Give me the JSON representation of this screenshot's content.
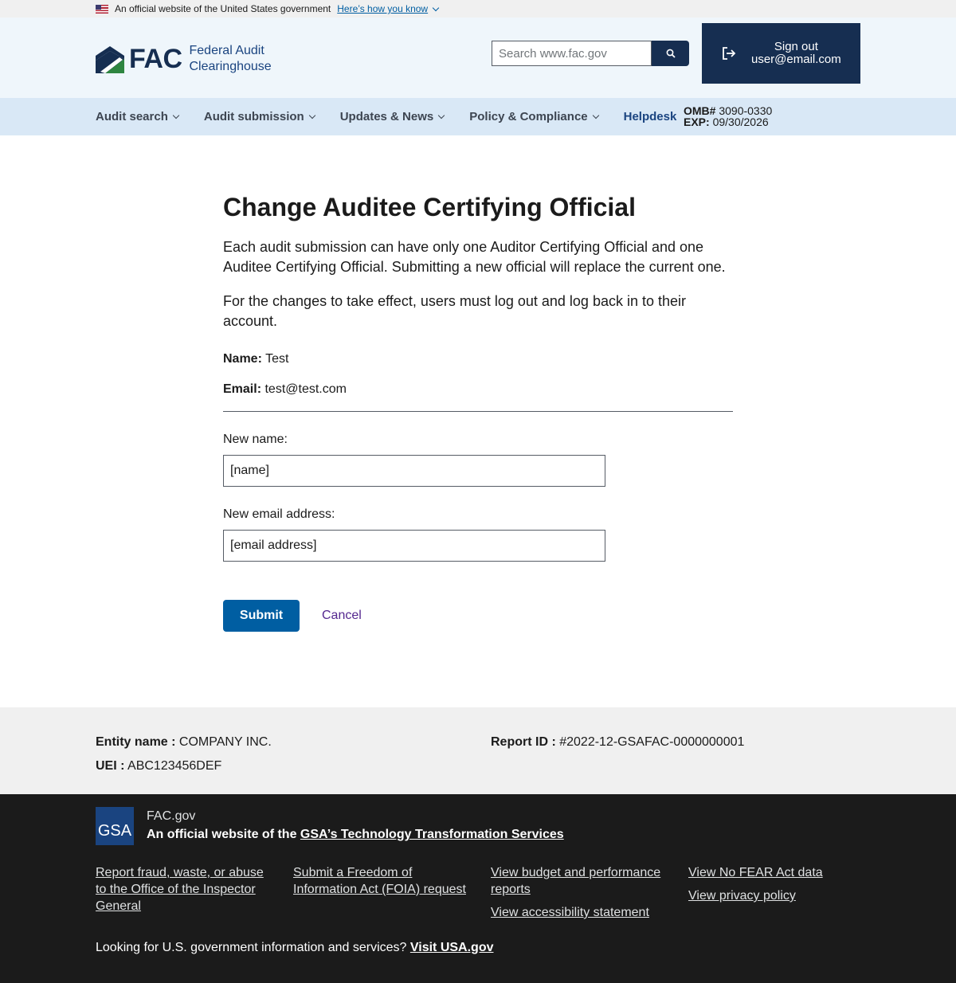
{
  "gov_banner": {
    "text": "An official website of the United States government",
    "link": "Here’s how you know"
  },
  "header": {
    "logo_short": "FAC",
    "logo_line1": "Federal Audit",
    "logo_line2": "Clearinghouse",
    "search_placeholder": "Search www.fac.gov",
    "signout_line1": "Sign out",
    "signout_line2": "user@email.com"
  },
  "nav": {
    "items": [
      {
        "label": "Audit search"
      },
      {
        "label": "Audit submission"
      },
      {
        "label": "Updates & News"
      },
      {
        "label": "Policy & Compliance"
      }
    ],
    "helpdesk": "Helpdesk",
    "omb_label": "OMB#",
    "omb_value": "3090-0330",
    "exp_label": "EXP:",
    "exp_value": "09/30/2026"
  },
  "main": {
    "title": "Change Auditee Certifying Official",
    "paragraph1": "Each audit submission can have only one Auditor Certifying Official and one Auditee Certifying Official. Submitting a new official will replace the current one.",
    "paragraph2": "For the changes to take effect, users must log out and log back in to their account.",
    "name_label": "Name:",
    "name_value": "Test",
    "email_label": "Email:",
    "email_value": "test@test.com",
    "new_name_label": "New name:",
    "new_name_value": "[name]",
    "new_email_label": "New email address:",
    "new_email_value": "[email address]",
    "submit_label": "Submit",
    "cancel_label": "Cancel"
  },
  "summary": {
    "entity_label": "Entity name :",
    "entity_value": "COMPANY INC.",
    "uei_label": "UEI :",
    "uei_value": "ABC123456DEF",
    "report_label": "Report ID :",
    "report_value": "#2022-12-GSAFAC-0000000001"
  },
  "footer": {
    "gsa_logo": "GSA",
    "site": "FAC.gov",
    "official_prefix": "An official website of the",
    "official_link": "GSA’s Technology Transformation Services",
    "links": {
      "fraud": "Report fraud, waste, or abuse to the Office of the Inspector General",
      "foia": "Submit a Freedom of Information Act (FOIA) request",
      "budget": "View budget and performance reports",
      "accessibility": "View accessibility statement",
      "nofear": "View No FEAR Act data",
      "privacy": "View privacy policy"
    },
    "looking_text": "Looking for U.S. government information and services?",
    "usa_link": "Visit USA.gov"
  },
  "colors": {
    "primary": "#005ea2",
    "navy": "#162e51",
    "header_bg": "#eff6fb",
    "nav_bg": "#d9e8f6",
    "footer_bg": "#1b1b1b",
    "cancel_link": "#54278f"
  }
}
